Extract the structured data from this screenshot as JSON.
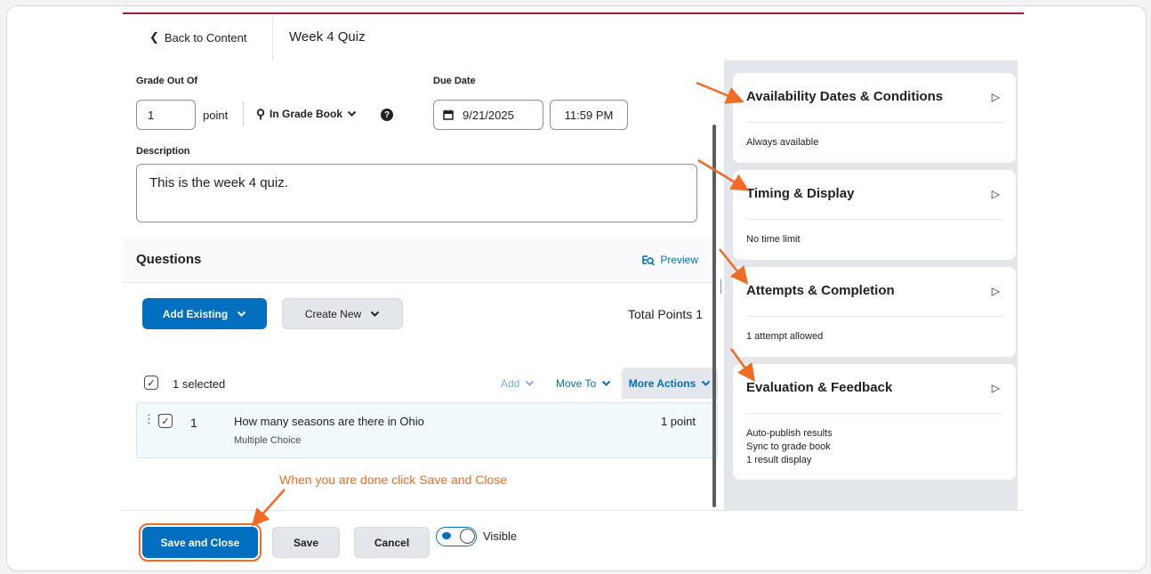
{
  "header": {
    "back_label": "Back to Content",
    "page_title": "Week 4 Quiz"
  },
  "grade": {
    "label": "Grade Out Of",
    "value": "1",
    "unit": "point",
    "gradebook_label": "In Grade Book"
  },
  "due": {
    "label": "Due Date",
    "date": "9/21/2025",
    "time": "11:59 PM"
  },
  "description": {
    "label": "Description",
    "value": "This is the week 4 quiz."
  },
  "questions": {
    "title": "Questions",
    "preview_label": "Preview",
    "add_existing_label": "Add Existing",
    "create_new_label": "Create New",
    "total_points": "Total Points 1",
    "selected_text": "1 selected",
    "add_label": "Add",
    "move_to_label": "Move To",
    "more_actions_label": "More Actions",
    "items": [
      {
        "number": "1",
        "text": "How many seasons are there in Ohio",
        "type": "Multiple Choice",
        "points": "1 point"
      }
    ]
  },
  "annotation": {
    "text": "When you are done click Save and Close",
    "color": "#f26b24"
  },
  "footer": {
    "save_close_label": "Save and Close",
    "save_label": "Save",
    "cancel_label": "Cancel",
    "visible_label": "Visible"
  },
  "sidebar": {
    "cards": [
      {
        "title": "Availability Dates & Conditions",
        "lines": [
          "Always available"
        ]
      },
      {
        "title": "Timing & Display",
        "lines": [
          "No time limit"
        ]
      },
      {
        "title": "Attempts & Completion",
        "lines": [
          "1 attempt allowed"
        ]
      },
      {
        "title": "Evaluation & Feedback",
        "lines": [
          "Auto-publish results",
          "Sync to grade book",
          "1 result display"
        ]
      }
    ]
  },
  "colors": {
    "primary": "#006fbf",
    "accent_red": "#a6192e",
    "annotation": "#f26b24"
  }
}
